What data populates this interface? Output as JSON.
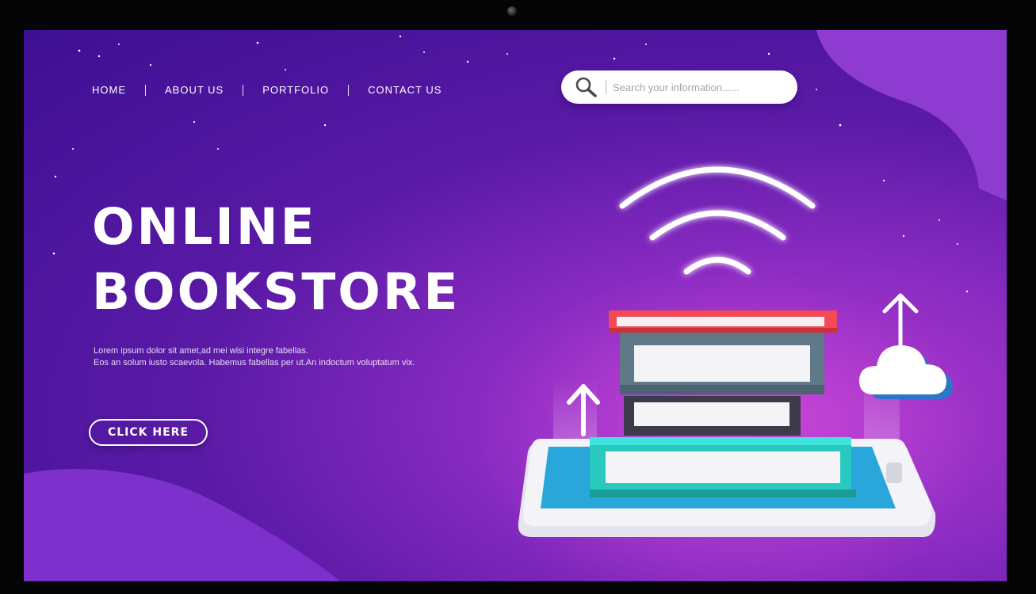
{
  "nav": {
    "items": [
      {
        "label": "HOME"
      },
      {
        "label": "ABOUT US"
      },
      {
        "label": "PORTFOLIO"
      },
      {
        "label": "CONTACT US"
      }
    ]
  },
  "search": {
    "placeholder": "Search your information......",
    "icon": "search-icon"
  },
  "hero": {
    "title_line1": "ONLINE",
    "title_line2": "BOOKSTORE",
    "desc_line1": "Lorem ipsum dolor sit amet,ad mei wisi integre fabellas.",
    "desc_line2": "Eos an solum iusto scaevola. Habemus fabellas per ut.An indoctum voluptatum vix.",
    "cta_label": "CLICK HERE"
  },
  "colors": {
    "bg_dark": "#3d0f93",
    "bg_mid": "#8a2bc2",
    "bg_glow": "#b53ccf",
    "wave": "#8d3bd0",
    "book_red": "#f24b55",
    "book_slate": "#5f7989",
    "book_dark": "#3b3b4a",
    "book_teal": "#2fd5cd",
    "phone_screen": "#2aa7da",
    "phone_body": "#f2f2f6"
  }
}
